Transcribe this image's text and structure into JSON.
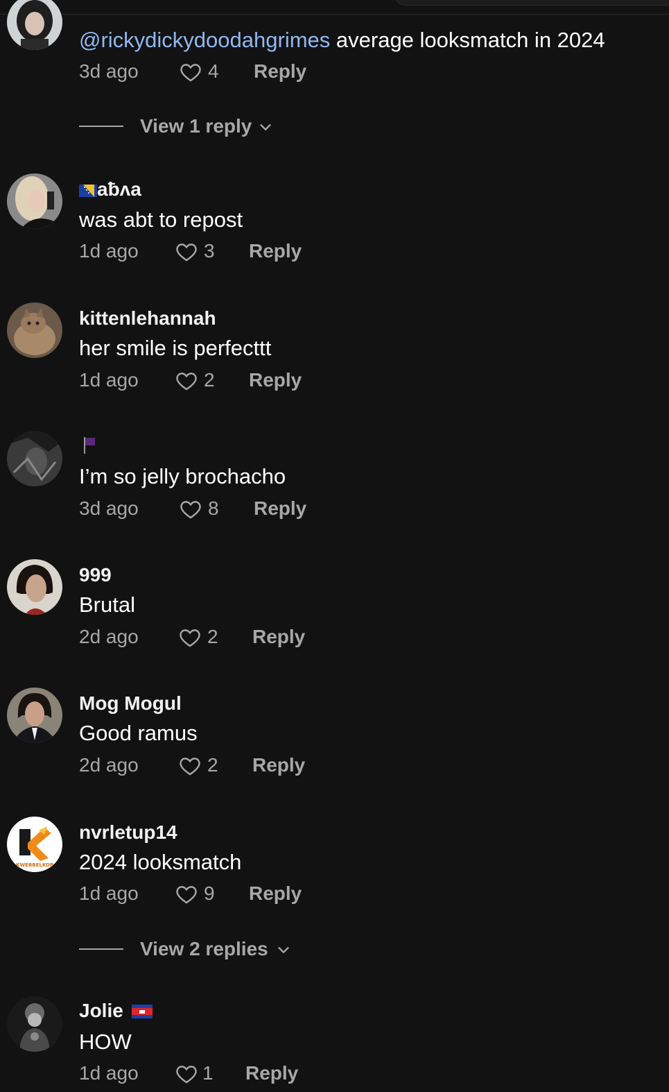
{
  "comments": [
    {
      "username": "",
      "mention": "@rickydickydoodahgrimes",
      "text": " average looksmatch in 2024",
      "time": "3d ago",
      "likes": "4",
      "reply": "Reply",
      "view_replies": "View 1 reply",
      "avatar_icon": "dark-haired-woman-avatar"
    },
    {
      "username": "aƀʌa",
      "text": "was abt to repost",
      "time": "1d ago",
      "likes": "3",
      "reply": "Reply",
      "flag_icon": "bosnia-flag-icon",
      "avatar_icon": "blonde-woman-avatar"
    },
    {
      "username": "kittenlehannah",
      "text": "her smile is perfecttt",
      "time": "1d ago",
      "likes": "2",
      "reply": "Reply",
      "avatar_icon": "cat-avatar"
    },
    {
      "username": "",
      "text": "I’m so jelly brochacho",
      "time": "3d ago",
      "likes": "8",
      "reply": "Reply",
      "flag_icon": "purple-flag-icon",
      "avatar_icon": "dark-photo-avatar"
    },
    {
      "username": "999",
      "text": "Brutal",
      "time": "2d ago",
      "likes": "2",
      "reply": "Reply",
      "avatar_icon": "dark-haired-man-avatar"
    },
    {
      "username": "Mog Mogul",
      "text": "Good ramus",
      "time": "2d ago",
      "likes": "2",
      "reply": "Reply",
      "avatar_icon": "man-in-suit-avatar"
    },
    {
      "username": "nvrletup14",
      "text": "2024 looksmatch",
      "time": "1d ago",
      "likes": "9",
      "reply": "Reply",
      "view_replies": "View 2 replies",
      "avatar_icon": "kwebbelkop-logo-avatar",
      "avatar_logo_text": "KWEBBELKOP"
    },
    {
      "username": "Jolie",
      "text": "HOW",
      "time": "1d ago",
      "likes": "1",
      "reply": "Reply",
      "flag_icon": "cambodia-flag-icon",
      "avatar_icon": "ornate-figure-avatar"
    }
  ],
  "colors": {
    "background": "#121212",
    "mention": "#8fb9f2",
    "meta": "#a8a8a8",
    "text": "#ffffff"
  }
}
